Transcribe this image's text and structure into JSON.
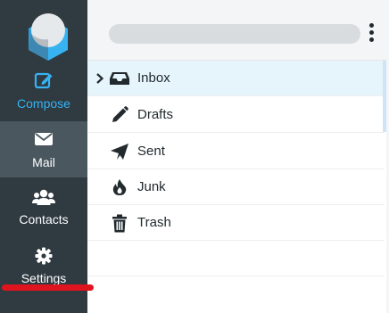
{
  "sidebar": {
    "items": [
      {
        "label": "Compose",
        "icon": "compose-icon"
      },
      {
        "label": "Mail",
        "icon": "envelope-icon"
      },
      {
        "label": "Contacts",
        "icon": "contacts-icon"
      },
      {
        "label": "Settings",
        "icon": "gear-icon"
      }
    ],
    "active_item": "Mail"
  },
  "search": {
    "value": ""
  },
  "folders": [
    {
      "name": "Inbox",
      "icon": "inbox-icon",
      "selected": true,
      "expandable": true
    },
    {
      "name": "Drafts",
      "icon": "pencil-icon"
    },
    {
      "name": "Sent",
      "icon": "paper-plane-icon"
    },
    {
      "name": "Junk",
      "icon": "fire-icon"
    },
    {
      "name": "Trash",
      "icon": "trash-icon"
    }
  ],
  "colors": {
    "sidebar_bg": "#2f3a41",
    "sidebar_active_bg": "#4a575f",
    "accent": "#37b3f2",
    "selected_row_bg": "#e6f4fc",
    "annotation_mark": "#e0141e"
  }
}
